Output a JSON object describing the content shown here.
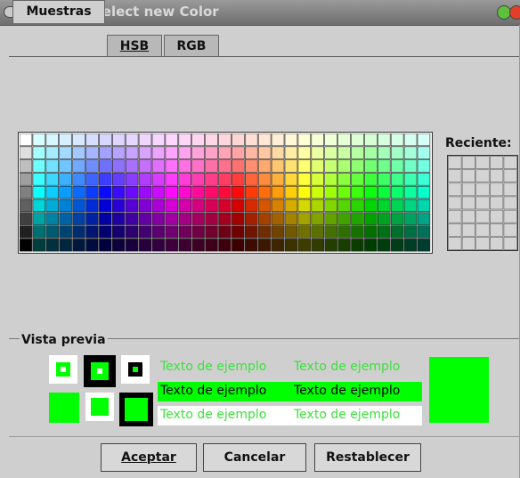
{
  "window": {
    "title": "Select new Color",
    "titlebar_bg": "#7a7a7a"
  },
  "tabs": [
    {
      "label": "Muestras",
      "active": true
    },
    {
      "label": "HSB",
      "active": false
    },
    {
      "label": "RGB",
      "active": false
    }
  ],
  "recent": {
    "label": "Reciente:"
  },
  "preview": {
    "label": "Vista previa",
    "sample_text": "Texto de ejemplo",
    "selected_color": "#00ff00"
  },
  "buttons": {
    "accept": "Aceptar",
    "cancel": "Cancelar",
    "reset": "Restablecer"
  },
  "swatches": {
    "columns": 31,
    "rows": 9,
    "recent_columns": 5,
    "recent_rows": 7
  }
}
